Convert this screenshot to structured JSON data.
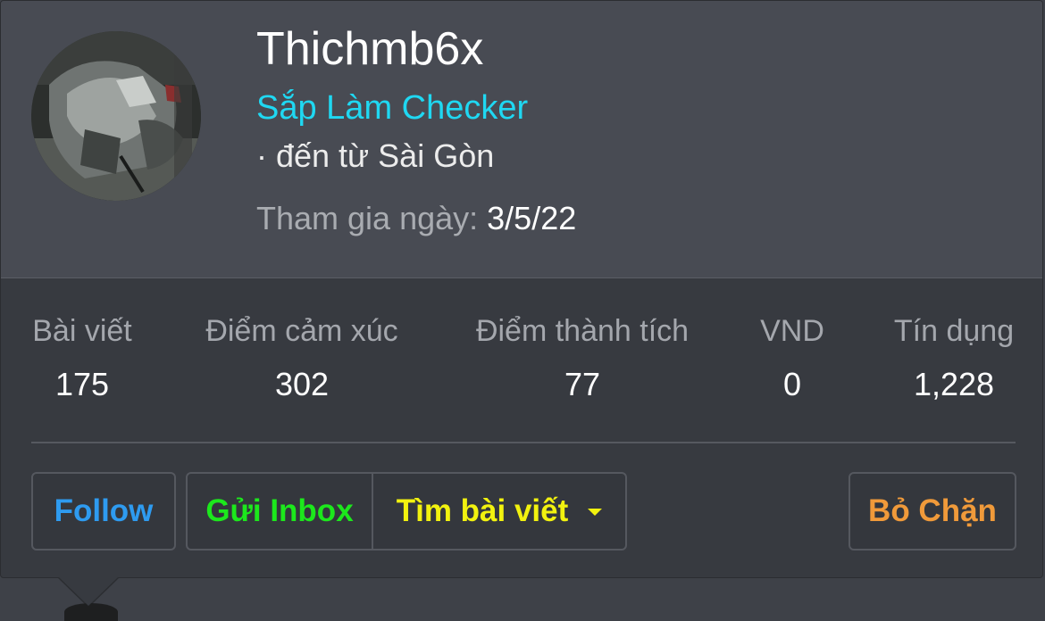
{
  "profile": {
    "username": "Thichmb6x",
    "title": "Sắp Làm Checker",
    "location": "· đến từ Sài Gòn",
    "join_label": "Tham gia ngày:",
    "join_date": "3/5/22",
    "avatar_icon": "user-avatar-motorbike"
  },
  "stats": [
    {
      "label": "Bài viết",
      "value": "175"
    },
    {
      "label": "Điểm cảm xúc",
      "value": "302"
    },
    {
      "label": "Điểm thành tích",
      "value": "77"
    },
    {
      "label": "VND",
      "value": "0"
    },
    {
      "label": "Tín dụng",
      "value": "1,228"
    }
  ],
  "actions": {
    "follow": "Follow",
    "inbox": "Gửi Inbox",
    "search_posts": "Tìm bài viết",
    "unblock": "Bỏ Chặn"
  },
  "colors": {
    "title": "#1fd8f2",
    "follow": "#2e9bf0",
    "inbox": "#1ce81c",
    "search": "#f2f20f",
    "unblock": "#f09a3a"
  }
}
